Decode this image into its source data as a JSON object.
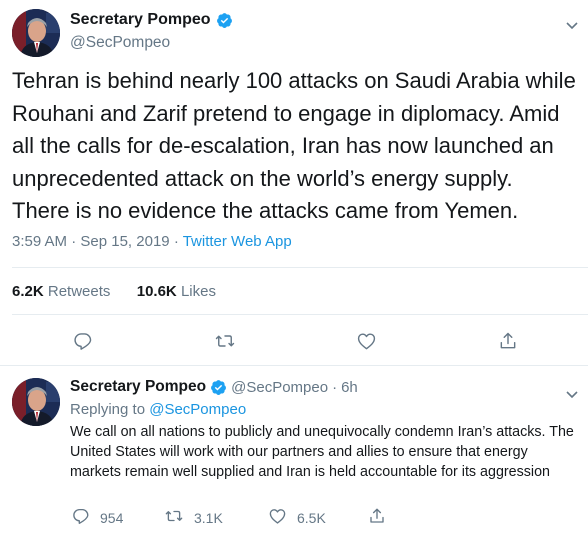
{
  "main_tweet": {
    "display_name": "Secretary Pompeo",
    "handle": "@SecPompeo",
    "text_lines": [
      "Tehran is behind nearly 100 attacks on Saudi Arabia while",
      "Rouhani and Zarif pretend to engage in diplomacy. Amid",
      "all the calls for de-escalation, Iran has now launched an",
      "unprecedented attack on the world’s energy supply.",
      "There is no evidence the attacks came from Yemen."
    ],
    "time": "3:59 AM",
    "date": "Sep 15, 2019",
    "separator": "·",
    "source": "Twitter Web App",
    "retweets_count": "6.2K",
    "retweets_label": "Retweets",
    "likes_count": "10.6K",
    "likes_label": "Likes",
    "icons": {
      "verified": "verified-badge-icon",
      "more": "chevron-down-icon",
      "reply": "reply-icon",
      "retweet": "retweet-icon",
      "like": "heart-icon",
      "share": "share-icon"
    }
  },
  "reply_tweet": {
    "display_name": "Secretary Pompeo",
    "handle": "@SecPompeo",
    "separator": "·",
    "time": "6h",
    "replying_prefix": "Replying to",
    "replying_to": "@SecPompeo",
    "text": "We call on all nations to publicly and unequivocally condemn Iran’s attacks. The United States will work with our partners and allies to ensure that energy markets remain well supplied and Iran is held accountable for its aggression",
    "reply_count": "954",
    "retweet_count": "3.1K",
    "like_count": "6.5K"
  },
  "colors": {
    "text_primary": "#14171a",
    "text_secondary": "#657786",
    "link": "#1b95e0",
    "verified": "#1da1f2",
    "divider": "#e6ecf0",
    "background": "#ffffff"
  }
}
